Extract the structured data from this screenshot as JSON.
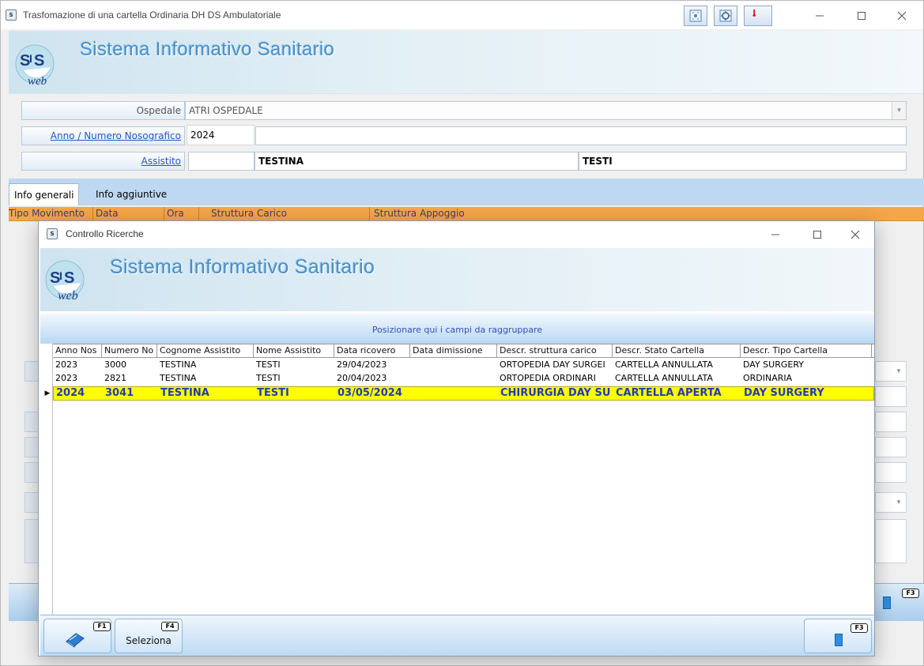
{
  "main_window": {
    "title": "Trasfomazione di una cartella Ordinaria DH DS  Ambulatoriale",
    "brand": "Sistema Informativo Sanitario",
    "logo_text": "web",
    "form": {
      "ospedale_label": "Ospedale",
      "ospedale_value": "ATRI OSPEDALE",
      "anno_label": "Anno / Numero Nosografico",
      "anno_value": "2024",
      "numero_value": "",
      "assistito_label": "Assistito",
      "assistito_code": "",
      "cognome": "TESTINA",
      "nome": "TESTI"
    },
    "tabs": [
      "Info generali",
      "Info aggiuntive"
    ],
    "grid_headers": [
      "Tipo Movimento",
      "Data",
      "Ora",
      "Struttura Carico",
      "Struttura Appoggio"
    ],
    "footer_fkey": "F3"
  },
  "dialog": {
    "title": "Controllo Ricerche",
    "brand": "Sistema Informativo Sanitario",
    "logo_text": "web",
    "group_hint": "Posizionare qui i campi da raggruppare",
    "columns": [
      "Anno Nos",
      "Numero No",
      "Cognome Assistito",
      "Nome Assistito",
      "Data ricovero",
      "Data dimissione",
      "Descr. struttura carico",
      "Descr. Stato Cartella",
      "Descr. Tipo Cartella"
    ],
    "rows": [
      [
        "2023",
        "3000",
        "TESTINA",
        "TESTI",
        "29/04/2023",
        "",
        "ORTOPEDIA DAY SURGEI",
        "CARTELLA ANNULLATA",
        "DAY SURGERY"
      ],
      [
        "2023",
        "2821",
        "TESTINA",
        "TESTI",
        "20/04/2023",
        "",
        "ORTOPEDIA ORDINARI",
        "CARTELLA ANNULLATA",
        "ORDINARIA"
      ],
      [
        "2024",
        "3041",
        "TESTINA",
        "TESTI",
        "03/05/2024",
        "",
        "CHIRURGIA DAY  SU",
        "CARTELLA APERTA",
        "DAY SURGERY"
      ]
    ],
    "selected_row": 2,
    "footer": {
      "f1_key": "F1",
      "seleziona_key": "F4",
      "seleziona_label": "Seleziona",
      "f3_key": "F3"
    }
  },
  "colors": {
    "brand_text": "#4a8fc5",
    "grid_header_orange": "#f6a64a",
    "selected_row_yellow": "#ffff00",
    "selected_row_text": "#1e3ab8",
    "link_blue": "#2a55c9"
  }
}
